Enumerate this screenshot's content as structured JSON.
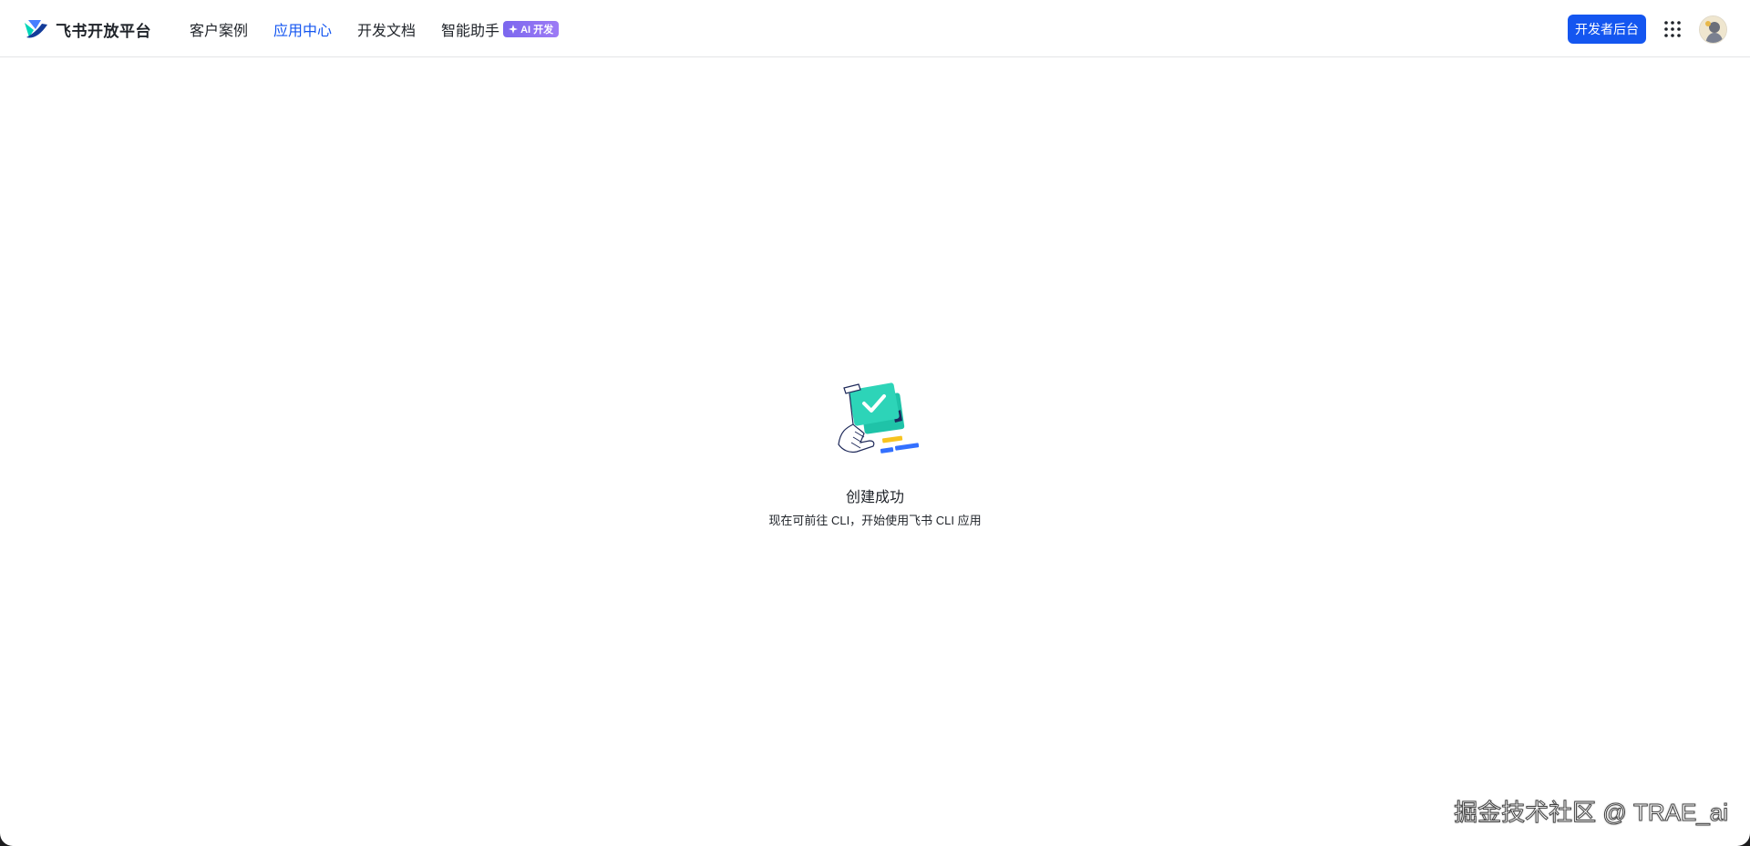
{
  "brand": {
    "name": "飞书开放平台"
  },
  "nav": {
    "items": [
      {
        "label": "客户案例"
      },
      {
        "label": "应用中心"
      },
      {
        "label": "开发文档"
      },
      {
        "label": "智能助手"
      }
    ],
    "active_index": 1,
    "ai_badge": "AI 开发"
  },
  "header": {
    "dev_console_label": "开发者后台"
  },
  "result": {
    "title": "创建成功",
    "description": "现在可前往 CLI，开始使用飞书 CLI 应用"
  },
  "watermark": {
    "text": "掘金技术社区 @ TRAE_ai"
  },
  "colors": {
    "accent": "#1456f0",
    "text": "#1f2329",
    "success": "#2dd4b8",
    "badge": "#8a6ff0"
  }
}
